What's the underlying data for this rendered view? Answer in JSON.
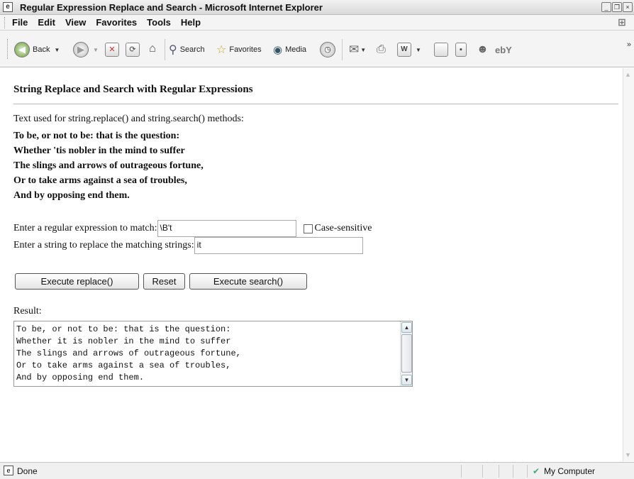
{
  "window": {
    "title": "Regular Expression Replace and Search - Microsoft Internet Explorer"
  },
  "menu": [
    "File",
    "Edit",
    "View",
    "Favorites",
    "Tools",
    "Help"
  ],
  "toolbar": {
    "back_label": "Back",
    "search_label": "Search",
    "favorites_label": "Favorites",
    "media_label": "Media"
  },
  "page": {
    "heading": "String Replace and Search with Regular Expressions",
    "intro": "Text used for string.replace() and string.search() methods:",
    "poem_lines": [
      "To be, or not to be: that is the question:",
      "Whether 'tis nobler in the mind to suffer",
      "The slings and arrows of outrageous fortune,",
      "Or to take arms against a sea of troubles,",
      "And by opposing end them."
    ],
    "regex_label": "Enter a regular expression to match:",
    "regex_value": "\\B't",
    "case_label": "Case-sensitive",
    "case_checked": false,
    "replace_label": "Enter a string to replace the matching strings:",
    "replace_value": "it",
    "buttons": {
      "execute_replace": "Execute replace()",
      "reset": "Reset",
      "execute_search": "Execute search()"
    },
    "result_label": "Result:",
    "result_text": "To be, or not to be: that is the question:\nWhether it is nobler in the mind to suffer\nThe slings and arrows of outrageous fortune,\nOr to take arms against a sea of troubles,\nAnd by opposing end them."
  },
  "status": {
    "text": "Done",
    "zone": "My Computer"
  }
}
